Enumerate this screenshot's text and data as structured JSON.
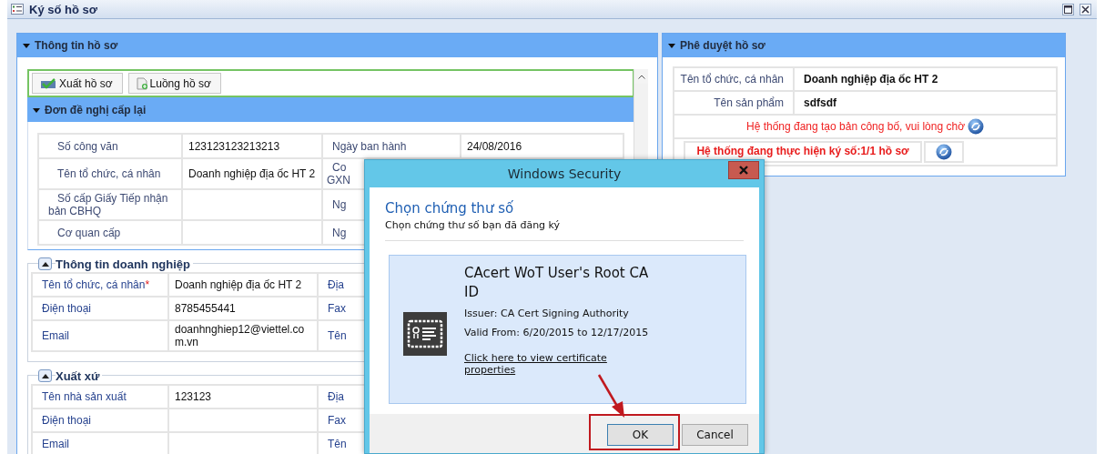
{
  "window": {
    "title": "Ký số hồ sơ"
  },
  "record_panel": {
    "title": "Thông tin hồ sơ",
    "expanded": true,
    "toolbar": [
      {
        "label": "Xuất hồ sơ",
        "kind": "export"
      },
      {
        "label": "Luồng hồ sơ",
        "kind": "flow"
      }
    ],
    "request_section": {
      "title": "Đơn đề nghị cấp lại",
      "expanded": true,
      "rows": [
        {
          "label": "Số công văn",
          "value": "123123123213213",
          "label_2": "Ngày ban hành",
          "value_2": "24/08/2016"
        },
        {
          "label": "Tên tổ chức, cá nhân",
          "value": "Doanh nghiệp địa ốc HT 2",
          "label_2": "Co\nGXN"
        },
        {
          "label": "Số cấp Giấy Tiếp nhận bản CBHQ",
          "label_2": "Ng"
        },
        {
          "label": "Cơ quan cấp",
          "label_2": "Ng"
        }
      ]
    },
    "business_section": {
      "title": "Thông tin doanh nghiệp",
      "expanded": true,
      "required_mark": "*",
      "rows": [
        {
          "label": "Tên tổ chức, cá nhân",
          "required": true,
          "value": "Doanh nghiệp địa ốc HT 2",
          "label_2": "Địa"
        },
        {
          "label": "Điện thoại",
          "required": false,
          "value": "8785455441",
          "label_2": "Fax"
        },
        {
          "label": "Email",
          "required": false,
          "value": "doanhnghiep12@viettel.com.vn",
          "label_2": "Tên"
        }
      ]
    },
    "origin_section": {
      "title": "Xuất xứ",
      "expanded": true,
      "rows": [
        {
          "label": "Tên nhà sản xuất",
          "value": "123123",
          "label_2": "Địa"
        },
        {
          "label": "Điện thoại",
          "label_2": "Fax"
        },
        {
          "label": "Email",
          "label_2": "Tên"
        }
      ]
    }
  },
  "approval_panel": {
    "title": "Phê duyệt hồ sơ",
    "expanded": true,
    "rows": [
      {
        "label": "Tên tổ chức, cá nhân",
        "value": "Doanh nghiệp địa ốc HT 2"
      },
      {
        "label": "Tên sản phẩm",
        "value": "sdfsdf"
      }
    ],
    "status_message": "Hệ thống đang tạo bản công bố, vui lòng chờ",
    "signing_message": "Hệ thống đang thực hiện ký số:1/1 hồ sơ"
  },
  "dialog": {
    "title": "Windows Security",
    "heading": "Chọn chứng thư số",
    "subheading": "Chọn chứng thư số bạn đã đăng ký",
    "certificate": {
      "name": "CAcert WoT User's Root CA ID",
      "issuer": "Issuer: CA Cert Signing Authority",
      "valid": "Valid From: 6/20/2015 to 12/17/2015",
      "link": "Click here to view certificate properties",
      "selected": true
    },
    "buttons": [
      {
        "label": "OK",
        "highlighted": true
      },
      {
        "label": "Cancel",
        "highlighted": false
      }
    ]
  }
}
